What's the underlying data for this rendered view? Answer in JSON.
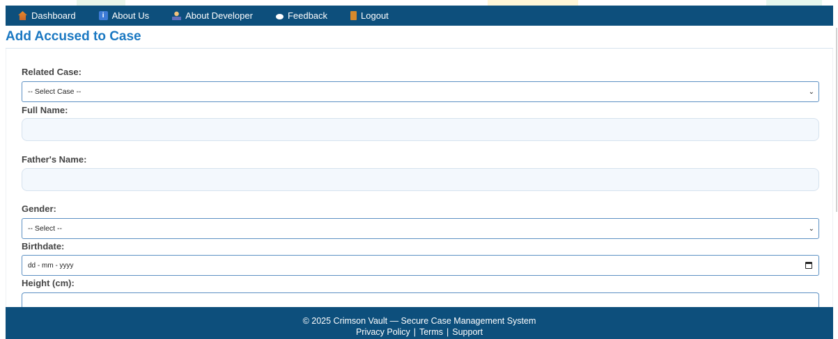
{
  "nav": {
    "items": [
      {
        "label": "Dashboard",
        "icon": "home-icon"
      },
      {
        "label": "About Us",
        "icon": "info-icon"
      },
      {
        "label": "About Developer",
        "icon": "developer-icon"
      },
      {
        "label": "Feedback",
        "icon": "chat-bubble-icon"
      },
      {
        "label": "Logout",
        "icon": "door-icon"
      }
    ]
  },
  "page": {
    "title": "Add Accused to Case"
  },
  "form": {
    "related_case": {
      "label": "Related Case:",
      "selected": "-- Select Case --"
    },
    "full_name": {
      "label": "Full Name:",
      "value": ""
    },
    "father_name": {
      "label": "Father's Name:",
      "value": ""
    },
    "gender": {
      "label": "Gender:",
      "selected": "-- Select --"
    },
    "birthdate": {
      "label": "Birthdate:",
      "placeholder": "dd - mm - yyyy"
    },
    "height": {
      "label": "Height (cm):",
      "value": ""
    }
  },
  "footer": {
    "copyright": "© 2025 Crimson Vault — Secure Case Management System",
    "links": [
      "Privacy Policy",
      "Terms",
      "Support"
    ],
    "separator": "|"
  },
  "colors": {
    "nav_bg": "#0d4f7c",
    "title": "#1a78c2",
    "input_border": "#5b8fc2",
    "input_fill": "#f3f8fd"
  }
}
